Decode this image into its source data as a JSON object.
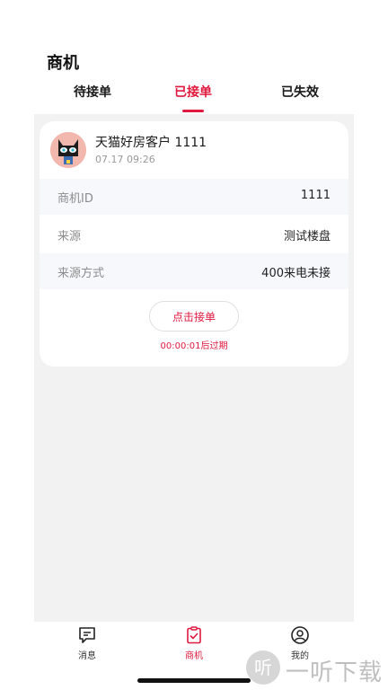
{
  "header": {
    "title": "商机"
  },
  "tabs": [
    {
      "label": "待接单"
    },
    {
      "label": "已接单"
    },
    {
      "label": "已失效"
    }
  ],
  "card": {
    "customer_name": "天猫好房客户 1111",
    "time": "07.17 09:26",
    "rows": [
      {
        "label": "商机ID",
        "value": "1111"
      },
      {
        "label": "来源",
        "value": "测试楼盘"
      },
      {
        "label": "来源方式",
        "value": "400来电未接"
      }
    ],
    "accept_label": "点击接单",
    "expire_text": "00:00:01后过期"
  },
  "tabbar": [
    {
      "label": "消息",
      "icon": "message-icon"
    },
    {
      "label": "商机",
      "icon": "clipboard-check-icon"
    },
    {
      "label": "我的",
      "icon": "user-icon"
    }
  ],
  "watermark": {
    "text": "一听下载",
    "glyph": "听"
  },
  "colors": {
    "accent": "#e0193e",
    "background": "#f2f2f2"
  }
}
